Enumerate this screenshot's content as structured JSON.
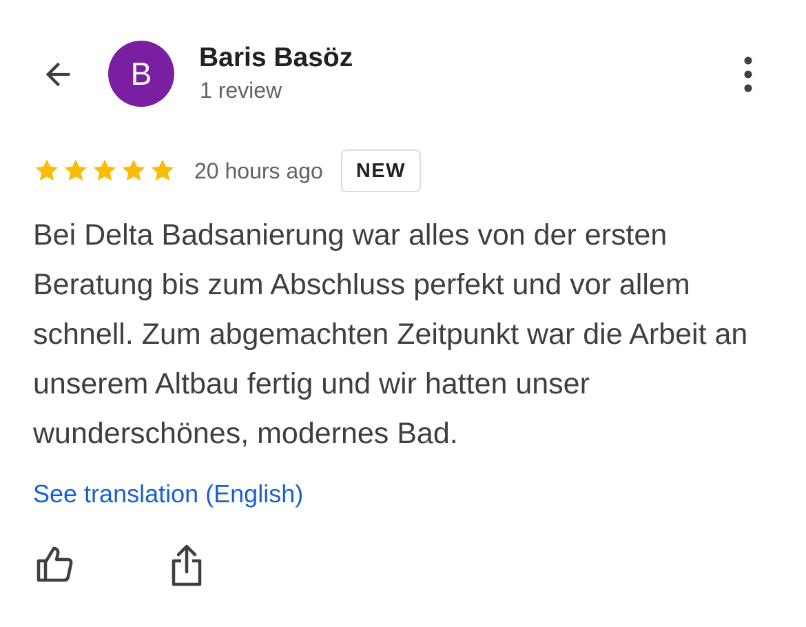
{
  "header": {
    "back_icon": "arrow-left-icon",
    "avatar_initial": "B",
    "avatar_color": "#7b1fa2",
    "author_name": "Baris Basöz",
    "review_count": "1 review",
    "more_icon": "more-vertical-icon"
  },
  "review": {
    "rating": 5,
    "rating_max": 5,
    "star_color": "#fbbc04",
    "timestamp": "20 hours ago",
    "badge": "NEW",
    "text": "Bei Delta Badsanierung war alles von der ersten Beratung bis zum Abschluss perfekt und vor allem schnell. Zum abgemachten Zeitpunkt war die Arbeit an unserem Altbau fertig und wir hatten unser wunderschönes, modernes Bad.",
    "translate_link": "See translation (English)",
    "link_color": "#1a5fd0"
  },
  "actions": {
    "like_icon": "thumbs-up-icon",
    "share_icon": "share-icon"
  }
}
